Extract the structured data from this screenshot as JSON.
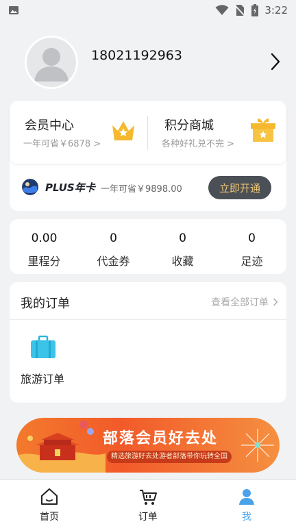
{
  "status_bar": {
    "time": "3:22",
    "icons": [
      "image-icon",
      "wifi-icon",
      "no-sim-icon",
      "battery-charging-icon"
    ]
  },
  "profile": {
    "phone": "18021192963",
    "avatar_icon": "default-avatar-icon",
    "arrow_icon": "chevron-right-icon"
  },
  "member": {
    "left": {
      "title": "会员中心",
      "subtitle": "一年可省￥6878 >",
      "icon": "crown-icon"
    },
    "right": {
      "title": "积分商城",
      "subtitle": "各种好礼兑不完 >",
      "icon": "gift-icon"
    }
  },
  "plus": {
    "title": "PLUS年卡",
    "subtitle": "一年可省￥9898.00",
    "button": "立即开通",
    "logo_icon": "plus-globe-icon"
  },
  "stats": [
    {
      "value": "0.00",
      "label": "里程分"
    },
    {
      "value": "0",
      "label": "代金券"
    },
    {
      "value": "0",
      "label": "收藏"
    },
    {
      "value": "0",
      "label": "足迹"
    }
  ],
  "orders": {
    "title": "我的订单",
    "view_all": "查看全部订单",
    "items": [
      {
        "label": "旅游订单",
        "icon": "luggage-icon"
      }
    ]
  },
  "banner": {
    "title": "部落会员好去处",
    "subtitle": "精选旅游好去处游者部落带你玩转全国"
  },
  "nav": [
    {
      "label": "首页",
      "icon": "home-icon",
      "active": false
    },
    {
      "label": "订单",
      "icon": "cart-icon",
      "active": false
    },
    {
      "label": "我",
      "icon": "user-icon",
      "active": true
    }
  ],
  "colors": {
    "background": "#f1f2f4",
    "accent_blue": "#4aa3ea",
    "gold": "#f5b82e",
    "plus_button_bg": "#4b4f56",
    "plus_button_text": "#f3c974",
    "banner_orange": "#f25a2a"
  }
}
